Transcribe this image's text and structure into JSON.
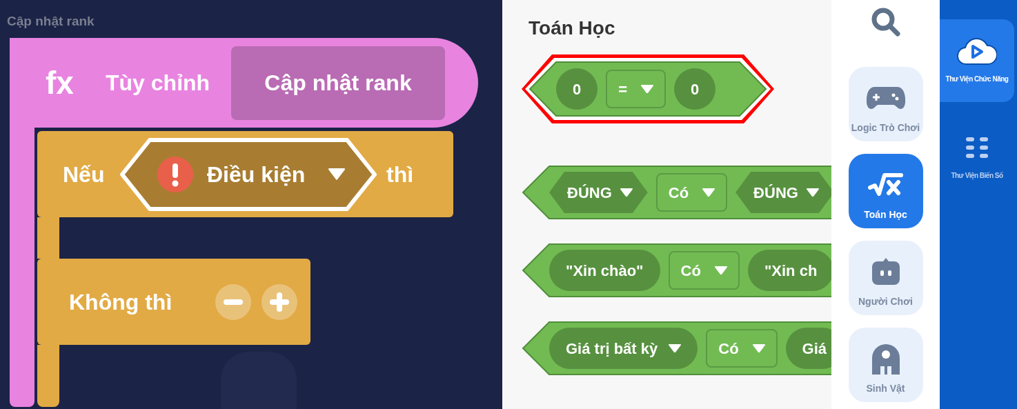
{
  "canvas": {
    "function_name_label": "Cập nhật rank",
    "function_block": {
      "icon_text": "fx",
      "label": "Tùy chỉnh",
      "name": "Cập nhật rank"
    },
    "if_block": {
      "label": "Nếu",
      "condition": {
        "text": "Điều kiện",
        "warning": true
      },
      "then_label": "thì"
    },
    "else_block": {
      "label": "Không thì"
    }
  },
  "palette": {
    "title": "Toán Học",
    "blocks": [
      {
        "highlighted": true,
        "slots": [
          {
            "kind": "oval",
            "text": "0",
            "dropdown": false
          },
          {
            "kind": "select",
            "text": "=",
            "dropdown": true
          },
          {
            "kind": "oval",
            "text": "0",
            "dropdown": false
          }
        ]
      },
      {
        "highlighted": false,
        "slots": [
          {
            "kind": "hex",
            "text": "ĐÚNG",
            "dropdown": true
          },
          {
            "kind": "select",
            "text": "Có",
            "dropdown": true
          },
          {
            "kind": "hex",
            "text": "ĐÚNG",
            "dropdown": true
          }
        ]
      },
      {
        "highlighted": false,
        "slots": [
          {
            "kind": "oval",
            "text": "\"Xin chào\"",
            "dropdown": false
          },
          {
            "kind": "select",
            "text": "Có",
            "dropdown": true
          },
          {
            "kind": "oval",
            "text": "\"Xin ch",
            "dropdown": false
          }
        ]
      },
      {
        "highlighted": false,
        "slots": [
          {
            "kind": "oval",
            "text": "Giá trị bất kỳ",
            "dropdown": true
          },
          {
            "kind": "select",
            "text": "Có",
            "dropdown": true
          },
          {
            "kind": "oval",
            "text": "Giá",
            "dropdown": false
          }
        ]
      }
    ]
  },
  "categories": [
    {
      "label": "Logic Trò Chơi",
      "selected": false
    },
    {
      "label": "Toán Học",
      "selected": true
    },
    {
      "label": "Người Chơi",
      "selected": false
    },
    {
      "label": "Sinh Vật",
      "selected": false
    }
  ],
  "libraries": [
    {
      "label": "Thư Viện Chức Năng",
      "selected": true
    },
    {
      "label": "Thư Viện Biến Số",
      "selected": false
    }
  ]
}
